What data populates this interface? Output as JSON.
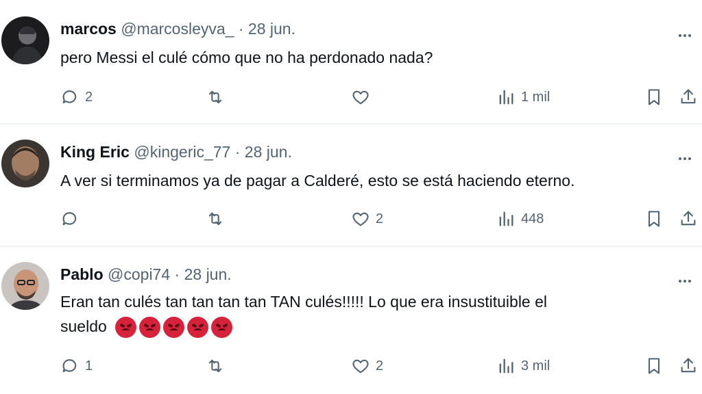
{
  "tweets": [
    {
      "name": "marcos",
      "handle": "@marcosleyva_",
      "separator": "·",
      "date": "28 jun.",
      "text": "pero Messi el culé cómo que no ha perdonado nada?",
      "replies": "2",
      "retweets": "",
      "likes": "",
      "views": "1 mil"
    },
    {
      "name": "King Eric",
      "handle": "@kingeric_77",
      "separator": "·",
      "date": "28 jun.",
      "text": "A ver si terminamos ya de pagar a Calderé, esto se está haciendo eterno.",
      "replies": "",
      "retweets": "",
      "likes": "2",
      "views": "448"
    },
    {
      "name": "Pablo",
      "handle": "@copi74",
      "separator": "·",
      "date": "28 jun.",
      "text_line1": "Eran tan culés tan tan tan tan TAN culés!!!!! Lo que era insustituible el",
      "text_line2": "sueldo",
      "replies": "1",
      "retweets": "",
      "likes": "2",
      "views": "3 mil"
    }
  ],
  "icons": {
    "reply": "reply-icon",
    "retweet": "retweet-icon",
    "like": "heart-icon",
    "views": "views-icon",
    "bookmark": "bookmark-icon",
    "share": "share-icon",
    "more": "more-icon",
    "emoji": "angry-face-emoji"
  },
  "colors": {
    "text": "#0f1419",
    "secondary": "#536471",
    "divider": "#eff3f4",
    "emoji": "#d6233b"
  }
}
